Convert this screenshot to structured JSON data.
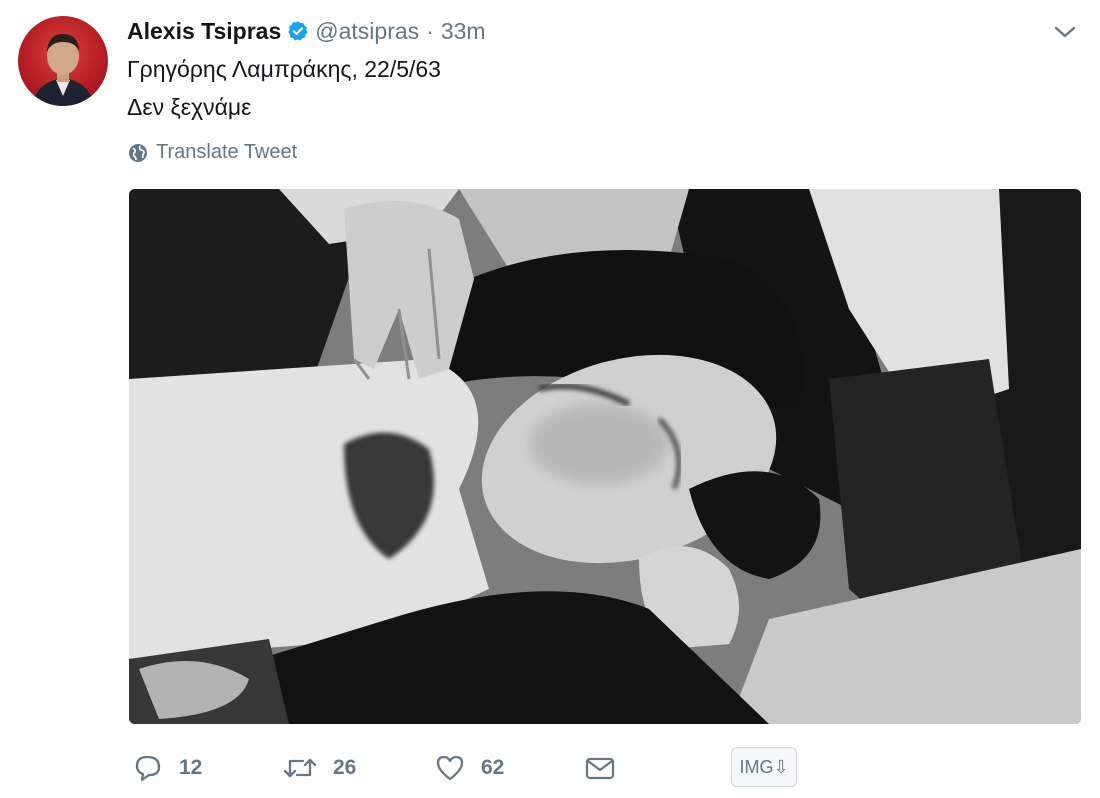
{
  "tweet": {
    "author_name": "Alexis Tsipras",
    "handle": "@atsipras",
    "separator": "·",
    "time": "33m",
    "text_line1": "Γρηγόρης Λαμπράκης, 22/5/63",
    "text_line2": "Δεν ξεχνάμε",
    "translate_label": "Translate Tweet"
  },
  "actions": {
    "reply_count": "12",
    "retweet_count": "26",
    "like_count": "62",
    "img_button_label": "IMG⇩"
  },
  "colors": {
    "text": "#14171a",
    "secondary": "#657786",
    "verified": "#1da1f2",
    "avatar_bg": "#c0232a"
  },
  "icons": [
    "verified-badge-icon",
    "caret-down-icon",
    "globe-icon",
    "reply-icon",
    "retweet-icon",
    "like-icon",
    "message-icon"
  ]
}
